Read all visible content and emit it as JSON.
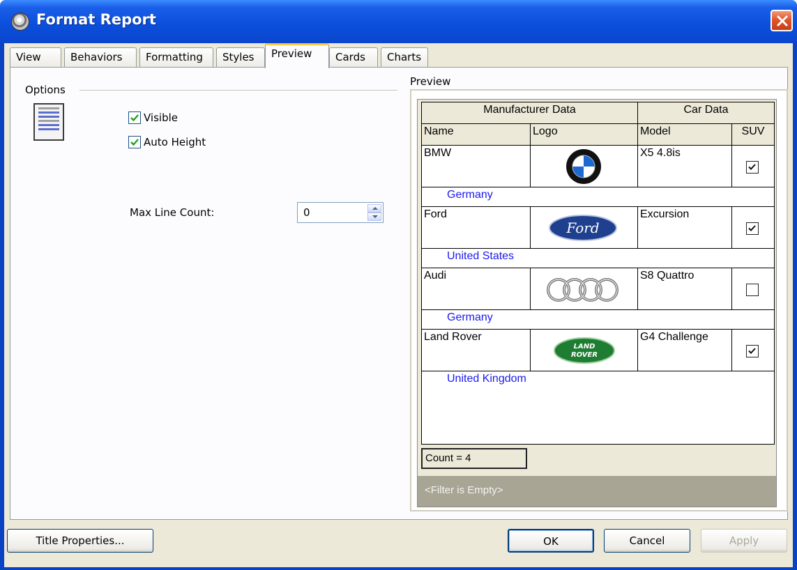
{
  "window": {
    "title": "Format Report"
  },
  "tabs": [
    {
      "label": "View",
      "active": false
    },
    {
      "label": "Behaviors",
      "active": false
    },
    {
      "label": "Formatting",
      "active": false
    },
    {
      "label": "Styles",
      "active": false
    },
    {
      "label": "Preview",
      "active": true
    },
    {
      "label": "Cards",
      "active": false
    },
    {
      "label": "Charts",
      "active": false
    }
  ],
  "options": {
    "heading": "Options",
    "visible_label": "Visible",
    "visible_checked": true,
    "auto_height_label": "Auto Height",
    "auto_height_checked": true,
    "max_line_count_label": "Max Line Count:",
    "max_line_count_value": "0"
  },
  "preview": {
    "heading": "Preview",
    "bands": [
      "Manufacturer Data",
      "Car Data"
    ],
    "columns": [
      "Name",
      "Logo",
      "Model",
      "SUV"
    ],
    "rows": [
      {
        "name": "BMW",
        "logo": "bmw-logo-icon",
        "model": "X5 4.8is",
        "suv": true,
        "country": "Germany"
      },
      {
        "name": "Ford",
        "logo": "ford-logo-icon",
        "model": "Excursion",
        "suv": true,
        "country": "United States"
      },
      {
        "name": "Audi",
        "logo": "audi-logo-icon",
        "model": "S8 Quattro",
        "suv": false,
        "country": "Germany"
      },
      {
        "name": "Land Rover",
        "logo": "land-rover-logo-icon",
        "model": "G4 Challenge",
        "suv": true,
        "country": "United Kingdom"
      }
    ],
    "ford_logo_text": "Ford",
    "land_rover_logo_text": [
      "LAND",
      "ROVER"
    ],
    "footer": "Count = 4",
    "filter": "<Filter is Empty>"
  },
  "buttons": {
    "title_properties": "Title Properties...",
    "ok": "OK",
    "cancel": "Cancel",
    "apply": "Apply"
  },
  "colors": {
    "titlebar": "#0b4fdd",
    "dialog_bg": "#ece9d8",
    "country_text": "#1a1aee",
    "filter_bar": "#a9a595",
    "active_tab_accent": "#ffc83c"
  }
}
